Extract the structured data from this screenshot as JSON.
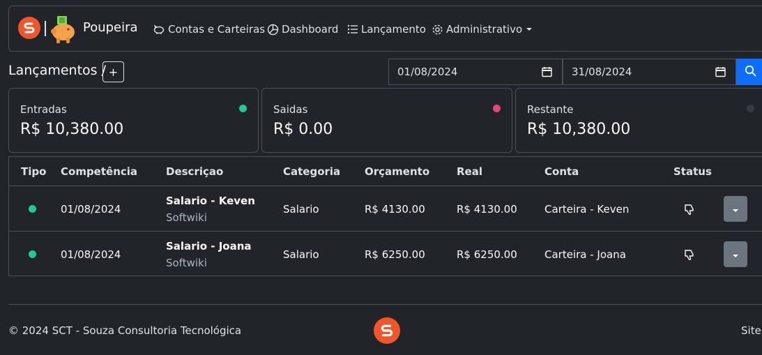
{
  "navbar": {
    "brand": "Poupeira",
    "logo_icon": "sct-logo-icon",
    "items": [
      {
        "label": "Contas e Carteiras",
        "icon": "piggy-bank-icon"
      },
      {
        "label": "Dashboard",
        "icon": "pie-chart-icon"
      },
      {
        "label": "Lançamento",
        "icon": "list-icon"
      },
      {
        "label": "Administrativo",
        "icon": "gear-icon",
        "dropdown": true
      }
    ]
  },
  "page": {
    "title": "Lançamentos /",
    "add_label": "+"
  },
  "filters": {
    "date_start": "01/08/2024",
    "date_end": "31/08/2024",
    "search_icon": "search-icon"
  },
  "summary": [
    {
      "label": "Entradas",
      "value": "R$ 10,380.00",
      "color": "#20c997"
    },
    {
      "label": "Saidas",
      "value": "R$ 0.00",
      "color": "#e8437a"
    },
    {
      "label": "Restante",
      "value": "R$ 10,380.00",
      "color": "#343a40"
    }
  ],
  "table": {
    "headers": [
      "Tipo",
      "Competência",
      "Descriçao",
      "Categoria",
      "Orçamento",
      "Real",
      "Conta",
      "Status"
    ],
    "rows": [
      {
        "tipo_color": "#20c997",
        "competencia": "01/08/2024",
        "descricao": "Salario - Keven",
        "subdescricao": "Softwiki",
        "categoria": "Salario",
        "orcamento": "R$ 4130.00",
        "real": "R$ 4130.00",
        "conta": "Carteira - Keven",
        "status_icon": "thumbs-down-icon"
      },
      {
        "tipo_color": "#20c997",
        "competencia": "01/08/2024",
        "descricao": "Salario - Joana",
        "subdescricao": "Softwiki",
        "categoria": "Salario",
        "orcamento": "R$ 6250.00",
        "real": "R$ 6250.00",
        "conta": "Carteira - Joana",
        "status_icon": "thumbs-down-icon"
      }
    ]
  },
  "footer": {
    "copyright": "© 2024 SCT - Souza Consultoria Tecnológica",
    "site": "Site"
  }
}
